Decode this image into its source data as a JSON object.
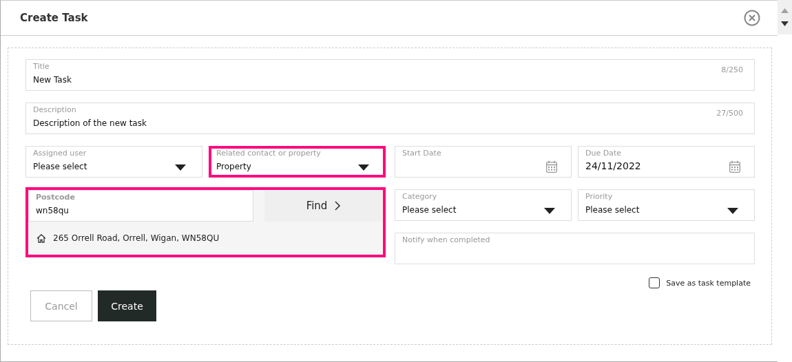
{
  "window": {
    "title": "Create Task"
  },
  "full_fields": [
    {
      "label": "Title",
      "value": "New Task",
      "counter": "8/250"
    },
    {
      "label": "Description",
      "value": "Description of the new task",
      "counter": "27/500"
    }
  ],
  "left_fields": [
    {
      "kind": "select",
      "label": "Assigned user",
      "value": "Please select",
      "highlighted": false
    },
    {
      "kind": "select",
      "label": "Related contact or property",
      "value": "Property",
      "highlighted": true
    }
  ],
  "postcode": {
    "label": "Postcode",
    "value": "wn58qu",
    "button": "Find",
    "highlighted": true,
    "results": [
      "265 Orrell Road, Orrell, Wigan, WN58QU"
    ]
  },
  "right_rows": [
    [
      {
        "kind": "date",
        "label": "Start Date"
      },
      {
        "kind": "date",
        "label": "Due Date",
        "value": "24/11/2022"
      }
    ],
    [
      {
        "kind": "select",
        "label": "Category",
        "value": "Please select"
      },
      {
        "kind": "select",
        "label": "Priority",
        "value": "Please select"
      }
    ],
    [
      {
        "kind": "text",
        "label": "Notify when completed"
      }
    ]
  ],
  "template_checkbox": {
    "label": "Save as task template",
    "checked": false
  },
  "buttons": [
    {
      "label": "Cancel",
      "kind": "secondary"
    },
    {
      "label": "Create",
      "kind": "primary"
    }
  ]
}
